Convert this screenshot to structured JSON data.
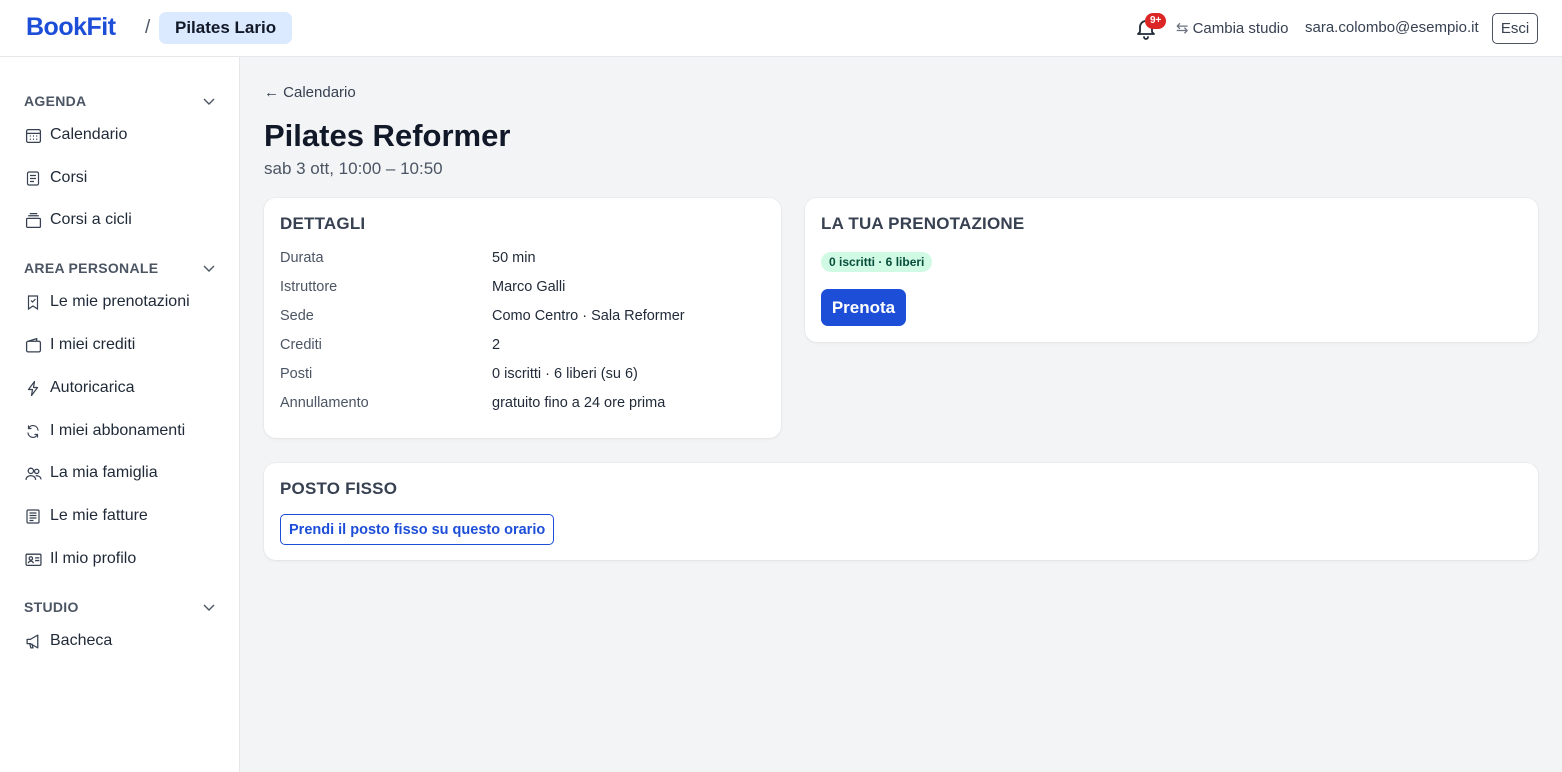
{
  "header": {
    "logo": "BookFit",
    "separator": "/",
    "studio_name": "Pilates Lario",
    "notifications_badge": "9+",
    "switch_studio": "Cambia studio",
    "user_email": "sara.colombo@esempio.it",
    "logout": "Esci"
  },
  "sidebar": {
    "sections": [
      {
        "title": "AGENDA",
        "items": [
          {
            "label": "Calendario",
            "icon": "calendar-icon"
          },
          {
            "label": "Corsi",
            "icon": "document-icon"
          },
          {
            "label": "Corsi a cicli",
            "icon": "stack-icon"
          }
        ]
      },
      {
        "title": "AREA PERSONALE",
        "items": [
          {
            "label": "Le mie prenotazioni",
            "icon": "bookmark-icon"
          },
          {
            "label": "I miei crediti",
            "icon": "wallet-icon"
          },
          {
            "label": "Autoricarica",
            "icon": "lightning-icon"
          },
          {
            "label": "I miei abbonamenti",
            "icon": "refresh-icon"
          },
          {
            "label": "La mia famiglia",
            "icon": "users-icon"
          },
          {
            "label": "Le mie fatture",
            "icon": "invoice-icon"
          },
          {
            "label": "Il mio profilo",
            "icon": "id-card-icon"
          }
        ]
      },
      {
        "title": "STUDIO",
        "items": [
          {
            "label": "Bacheca",
            "icon": "megaphone-icon"
          }
        ]
      }
    ]
  },
  "main": {
    "back_link": "← Calendario",
    "title": "Pilates Reformer",
    "subtitle": "sab 3 ott, 10:00 – 10:50",
    "details": {
      "title": "DETTAGLI",
      "rows": [
        {
          "label": "Durata",
          "value": "50 min"
        },
        {
          "label": "Istruttore",
          "value": "Marco Galli"
        },
        {
          "label": "Sede",
          "value": "Como Centro · Sala Reformer"
        },
        {
          "label": "Crediti",
          "value": "2"
        },
        {
          "label": "Posti",
          "value": "0 iscritti · 6 liberi (su 6)"
        },
        {
          "label": "Annullamento",
          "value": "gratuito fino a 24 ore prima"
        }
      ]
    },
    "booking": {
      "title": "LA TUA PRENOTAZIONE",
      "availability": "0 iscritti · 6 liberi",
      "book_button": "Prenota"
    },
    "fixed_spot": {
      "title": "POSTO FISSO",
      "button": "Prendi il posto fisso su questo orario"
    }
  },
  "colors": {
    "accent": "#1d4ed8",
    "pill_bg": "#dbeafe",
    "badge_red": "#dc2626",
    "success_bg": "#d1fae5"
  }
}
